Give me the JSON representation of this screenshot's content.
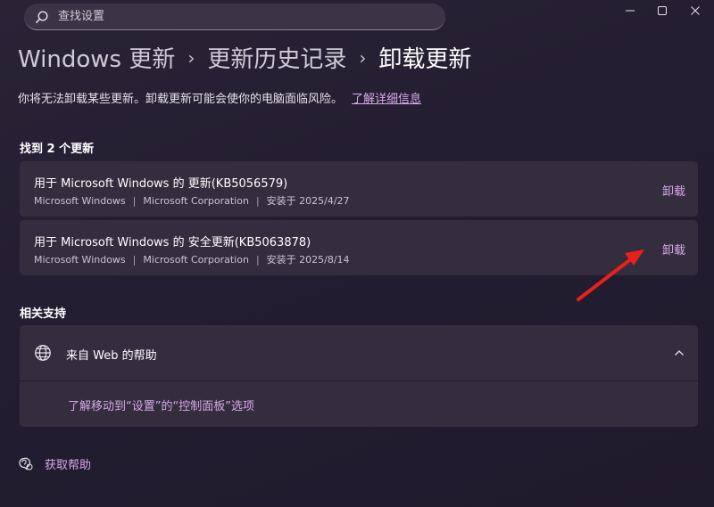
{
  "search": {
    "placeholder": "查找设置"
  },
  "breadcrumb": {
    "item1": "Windows 更新",
    "item2": "更新历史记录",
    "current": "卸载更新",
    "separator": "›"
  },
  "description": {
    "text": "你将无法卸载某些更新。卸载更新可能会使你的电脑面临风险。",
    "link": "了解详细信息"
  },
  "updates": {
    "title": "找到 2 个更新",
    "items": [
      {
        "name": "用于 Microsoft Windows 的 更新(KB5056579)",
        "publisher": "Microsoft Windows",
        "company": "Microsoft Corporation",
        "installed": "安装于 2025/4/27",
        "action": "卸载"
      },
      {
        "name": "用于 Microsoft Windows 的 安全更新(KB5063878)",
        "publisher": "Microsoft Windows",
        "company": "Microsoft Corporation",
        "installed": "安装于 2025/8/14",
        "action": "卸载"
      }
    ]
  },
  "related": {
    "title": "相关支持",
    "help_header": "来自 Web 的帮助",
    "help_link": "了解移动到“设置”的“控制面板”选项"
  },
  "get_help": {
    "label": "获取帮助"
  },
  "colors": {
    "accent": "#d7a9e8",
    "arrow": "#e8211c"
  },
  "separator_bar": "|"
}
